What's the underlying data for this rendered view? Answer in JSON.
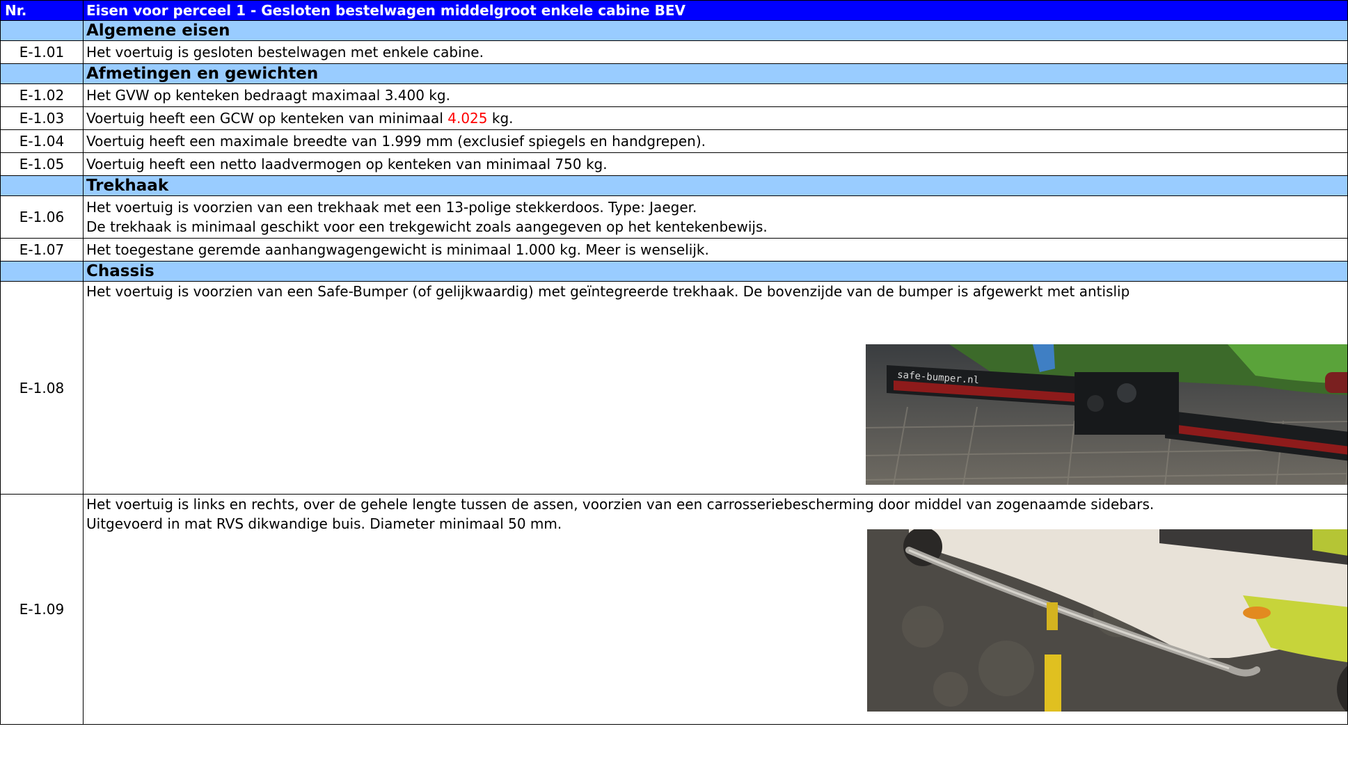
{
  "header": {
    "nr_label": "Nr.",
    "title": "Eisen voor perceel 1 - Gesloten bestelwagen middelgroot enkele cabine BEV"
  },
  "sections": {
    "algemeen": "Algemene eisen",
    "afmetingen": "Afmetingen en gewichten",
    "trekhaak": "Trekhaak",
    "chassis": "Chassis"
  },
  "rows": {
    "e101": {
      "nr": "E-1.01",
      "text": "Het voertuig is gesloten bestelwagen met enkele cabine."
    },
    "e102": {
      "nr": "E-1.02",
      "text": "Het GVW op kenteken bedraagt maximaal 3.400 kg."
    },
    "e103": {
      "nr": "E-1.03",
      "text_pre": "Voertuig heeft een GCW op kenteken van minimaal ",
      "text_red": "4.025",
      "text_post": " kg."
    },
    "e104": {
      "nr": "E-1.04",
      "text": "Voertuig heeft een maximale breedte van 1.999 mm (exclusief spiegels en handgrepen)."
    },
    "e105": {
      "nr": "E-1.05",
      "text": "Voertuig heeft een netto laadvermogen op kenteken van minimaal 750 kg."
    },
    "e106": {
      "nr": "E-1.06",
      "line1": "Het voertuig is voorzien van een trekhaak met een 13-polige stekkerdoos. Type: Jaeger.",
      "line2": "De trekhaak is minimaal geschikt voor een trekgewicht zoals aangegeven op het kentekenbewijs."
    },
    "e107": {
      "nr": "E-1.07",
      "text": "Het toegestane geremde aanhangwagengewicht is minimaal 1.000 kg. Meer is wenselijk."
    },
    "e108": {
      "nr": "E-1.08",
      "text": "Het voertuig is voorzien van een Safe-Bumper (of gelijkwaardig) met geïntegreerde trekhaak. De bovenzijde van de bumper is afgewerkt met antislip",
      "photo_text": "safe-bumper.nl"
    },
    "e109": {
      "nr": "E-1.09",
      "line1": "Het voertuig is links en rechts, over de gehele lengte tussen de assen, voorzien van een carrosseriebescherming door middel van zogenaamde sidebars.",
      "line2": "Uitgevoerd in mat RVS dikwandige buis. Diameter minimaal 50 mm."
    }
  },
  "colors": {
    "header_bg": "#0000ff",
    "section_bg": "#99ccff",
    "highlight_red": "#ff0000"
  }
}
